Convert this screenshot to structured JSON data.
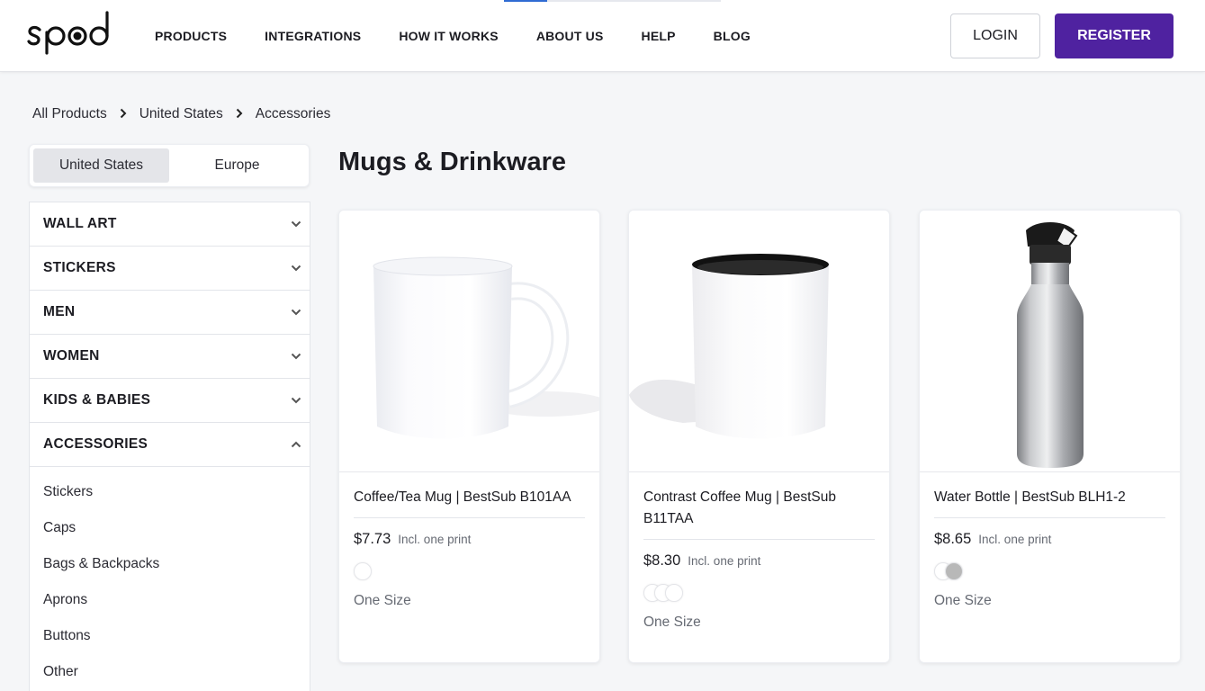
{
  "header": {
    "logo_text": "spod",
    "nav": [
      "PRODUCTS",
      "INTEGRATIONS",
      "HOW IT WORKS",
      "ABOUT US",
      "HELP",
      "BLOG"
    ],
    "login_label": "LOGIN",
    "register_label": "REGISTER",
    "accent_color": "#4f22a0"
  },
  "breadcrumb": [
    "All Products",
    "United States",
    "Accessories"
  ],
  "region_toggle": {
    "options": [
      "United States",
      "Europe"
    ],
    "selected": "United States"
  },
  "categories": [
    {
      "label": "WALL ART",
      "expanded": false
    },
    {
      "label": "STICKERS",
      "expanded": false
    },
    {
      "label": "MEN",
      "expanded": false
    },
    {
      "label": "WOMEN",
      "expanded": false
    },
    {
      "label": "KIDS & BABIES",
      "expanded": false
    },
    {
      "label": "ACCESSORIES",
      "expanded": true
    }
  ],
  "subcategories": [
    "Stickers",
    "Caps",
    "Bags & Backpacks",
    "Aprons",
    "Buttons",
    "Other"
  ],
  "page_title": "Mugs & Drinkware",
  "products": [
    {
      "title": "Coffee/Tea Mug | BestSub B101AA",
      "price": "$7.73",
      "price_note": "Incl. one print",
      "swatches": [
        "#ffffff"
      ],
      "size": "One Size",
      "image_icon": "mug-icon"
    },
    {
      "title": "Contrast Coffee Mug | BestSub B11TAA",
      "price": "$8.30",
      "price_note": "Incl. one print",
      "swatches": [
        "#ffffff",
        "#ffffff",
        "#ffffff"
      ],
      "size": "One Size",
      "image_icon": "contrast-mug-icon"
    },
    {
      "title": "Water Bottle | BestSub BLH1-2",
      "price": "$8.65",
      "price_note": "Incl. one print",
      "swatches": [
        "#ffffff",
        "#b8b8b8"
      ],
      "size": "One Size",
      "image_icon": "water-bottle-icon"
    }
  ]
}
